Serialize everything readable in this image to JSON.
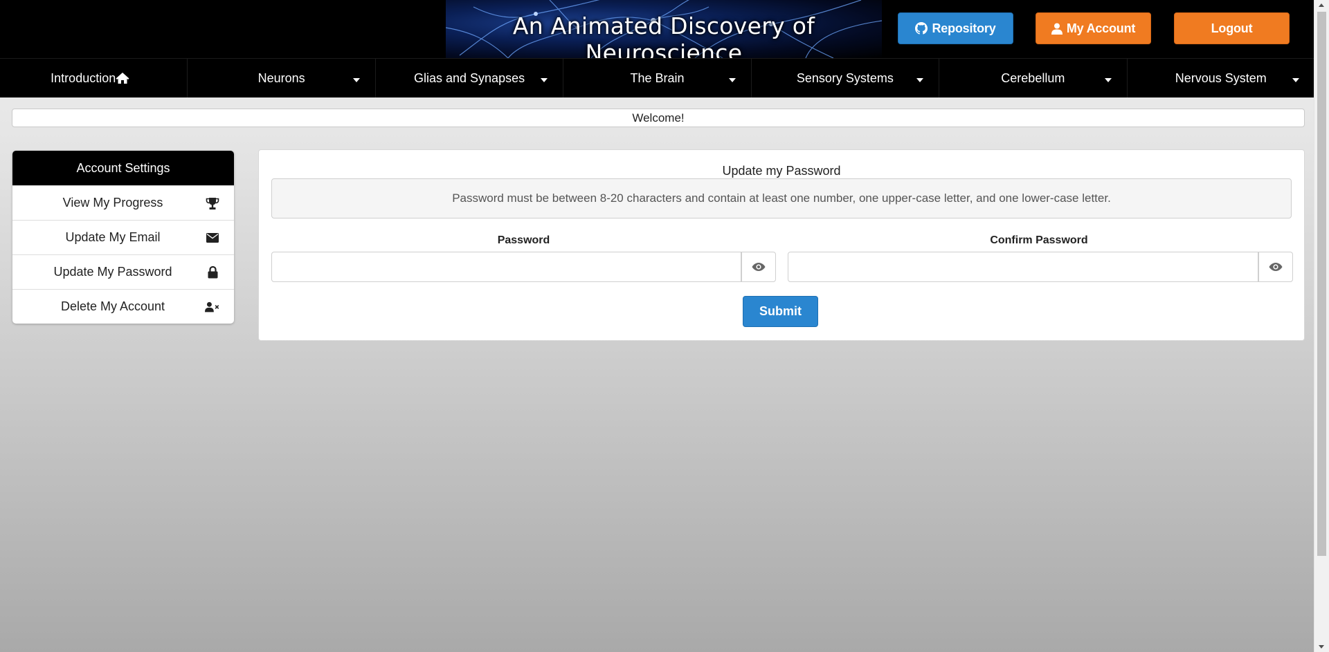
{
  "header": {
    "banner_title": "An Animated Discovery of Neuroscience",
    "repository_label": "Repository",
    "my_account_label": "My Account",
    "logout_label": "Logout"
  },
  "nav": {
    "items": [
      {
        "label": "Introduction",
        "icon": "home-icon",
        "dropdown": false
      },
      {
        "label": "Neurons",
        "dropdown": true
      },
      {
        "label": "Glias and Synapses",
        "dropdown": true
      },
      {
        "label": "The Brain",
        "dropdown": true
      },
      {
        "label": "Sensory Systems",
        "dropdown": true
      },
      {
        "label": "Cerebellum",
        "dropdown": true
      },
      {
        "label": "Nervous System",
        "dropdown": true
      }
    ]
  },
  "welcome": "Welcome!",
  "sidebar": {
    "title": "Account Settings",
    "items": [
      {
        "label": "View My Progress",
        "icon": "trophy-icon"
      },
      {
        "label": "Update My Email",
        "icon": "envelope-icon"
      },
      {
        "label": "Update My Password",
        "icon": "lock-icon"
      },
      {
        "label": "Delete My Account",
        "icon": "user-remove-icon"
      }
    ]
  },
  "main": {
    "title": "Update my Password",
    "notice": "Password must be between 8-20 characters and contain at least one number, one upper-case letter, and one lower-case letter.",
    "password_label": "Password",
    "confirm_label": "Confirm Password",
    "password_value": "",
    "confirm_value": "",
    "submit_label": "Submit"
  },
  "colors": {
    "primary_blue": "#2a86d0",
    "accent_orange": "#f07b21",
    "nav_background": "#000000"
  }
}
